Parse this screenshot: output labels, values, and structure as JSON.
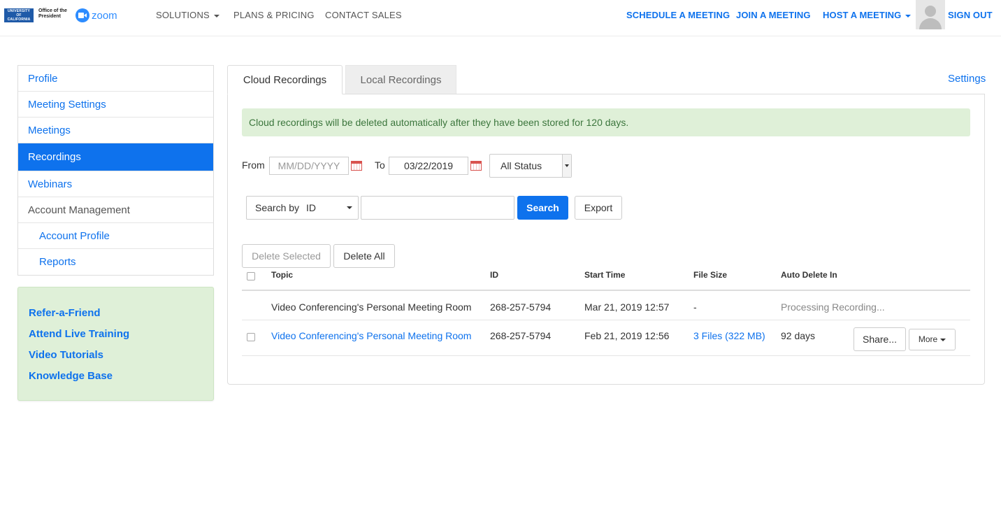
{
  "header": {
    "uc_logo_lines": [
      "UNIVERSITY",
      "OF",
      "CALIFORNIA"
    ],
    "office_text": "Office of the President",
    "zoom_text": "zoom",
    "nav_left": [
      "SOLUTIONS",
      "PLANS & PRICING",
      "CONTACT SALES"
    ],
    "schedule": "SCHEDULE A MEETING",
    "join": "JOIN A MEETING",
    "host": "HOST A MEETING",
    "sign_out": "SIGN OUT"
  },
  "sidebar": {
    "items": [
      {
        "label": "Profile"
      },
      {
        "label": "Meeting Settings"
      },
      {
        "label": "Meetings"
      },
      {
        "label": "Recordings"
      },
      {
        "label": "Webinars"
      },
      {
        "label": "Account Management"
      },
      {
        "label": "Account Profile"
      },
      {
        "label": "Reports"
      }
    ],
    "promo_links": [
      "Refer-a-Friend",
      "Attend Live Training",
      "Video Tutorials",
      "Knowledge Base"
    ]
  },
  "main": {
    "tabs": [
      "Cloud Recordings",
      "Local Recordings"
    ],
    "settings_label": "Settings",
    "notice": "Cloud recordings will be deleted automatically after they have been stored for 120 days.",
    "filter": {
      "from_label": "From",
      "from_placeholder": "MM/DD/YYYY",
      "to_label": "To",
      "to_value": "03/22/2019",
      "status": "All Status"
    },
    "search": {
      "by_label": "Search by",
      "by_value": "ID",
      "button": "Search",
      "export": "Export"
    },
    "actions": {
      "delete_selected": "Delete Selected",
      "delete_all": "Delete All"
    },
    "table": {
      "columns": [
        "Topic",
        "ID",
        "Start Time",
        "File Size",
        "Auto Delete In"
      ],
      "rows": [
        {
          "topic": "Video Conferencing's Personal Meeting Room",
          "id": "268-257-5794",
          "start": "Mar 21, 2019 12:57",
          "size": "-",
          "auto_delete": "Processing Recording..."
        },
        {
          "topic": "Video Conferencing's Personal Meeting Room",
          "id": "268-257-5794",
          "start": "Feb 21, 2019 12:56",
          "size": "3 Files (322 MB)",
          "auto_delete": "92 days",
          "share": "Share...",
          "more": "More"
        }
      ]
    }
  },
  "colors": {
    "accent": "#0e72ed",
    "notice_bg": "#dff0d8",
    "notice_text": "#3c763d"
  }
}
